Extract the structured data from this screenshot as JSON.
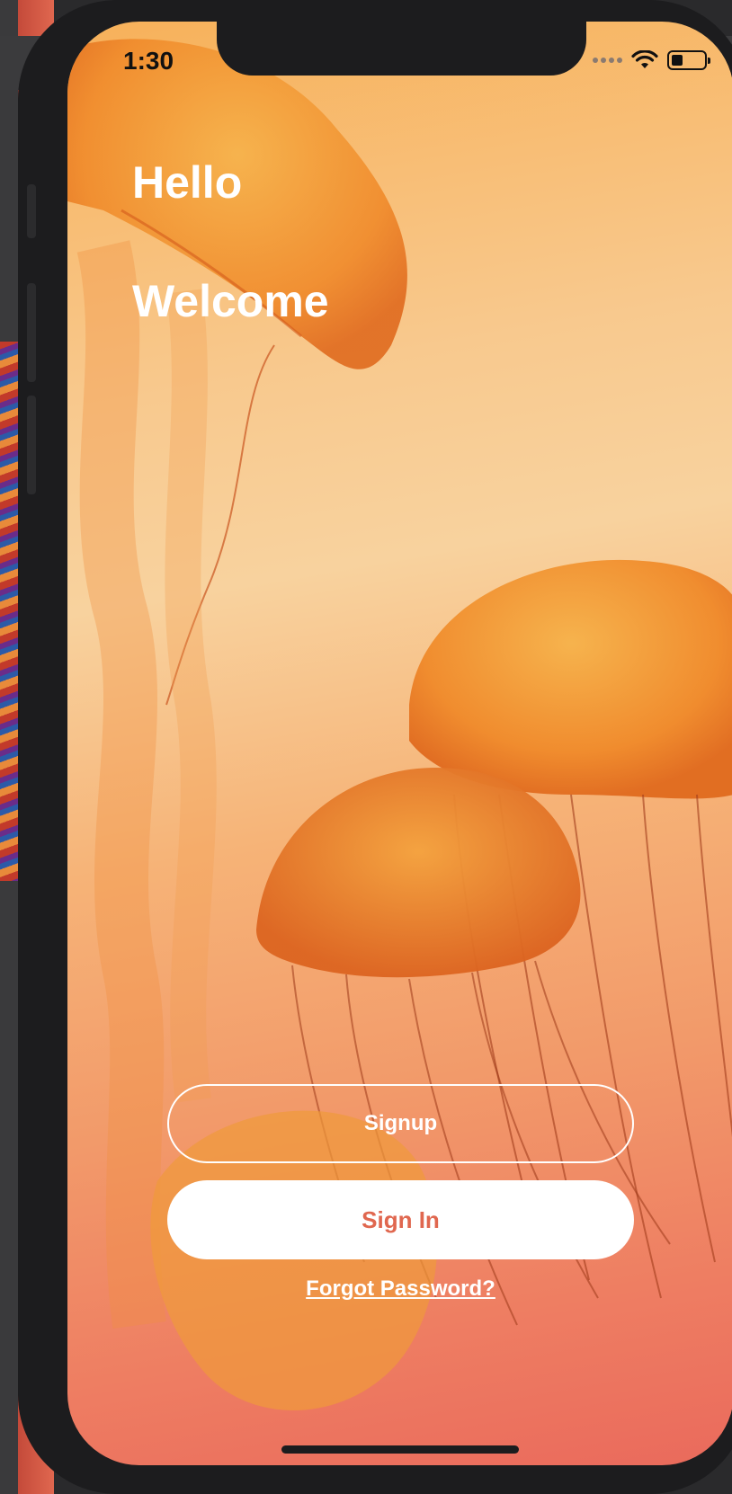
{
  "status_bar": {
    "time": "1:30",
    "wifi_icon": "wifi-icon",
    "battery_icon": "battery-icon"
  },
  "greeting": {
    "line1": "Hello",
    "line2": "Welcome"
  },
  "actions": {
    "signup_label": "Signup",
    "signin_label": "Sign In",
    "forgot_label": "Forgot Password?"
  },
  "colors": {
    "accent": "#e0674f",
    "text_light": "#ffffff",
    "background_top": "#f7b15a",
    "background_bottom": "#ea6a5c"
  }
}
